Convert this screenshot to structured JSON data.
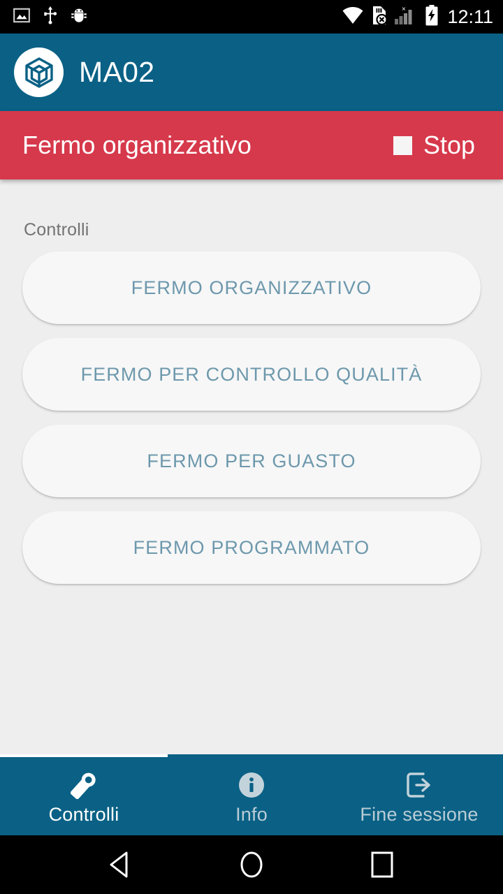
{
  "status_bar": {
    "time": "12:11",
    "left_icons": [
      "screenshot-icon",
      "usb-icon",
      "android-debug-icon"
    ],
    "right_icons": [
      "wifi-icon",
      "no-sim-card-icon",
      "cell-signal-icon",
      "battery-charging-icon"
    ]
  },
  "app_bar": {
    "title": "MA02",
    "logo_icon": "cube-logo-icon",
    "background_color": "#0a6185"
  },
  "alert_banner": {
    "message": "Fermo organizzativo",
    "action_label": "Stop",
    "action_icon": "stop-square-icon",
    "background_color": "#d6394b"
  },
  "content": {
    "section_label": "Controlli",
    "buttons": [
      {
        "label": "FERMO ORGANIZZATIVO"
      },
      {
        "label": "FERMO PER CONTROLLO QUALITÀ"
      },
      {
        "label": "FERMO PER GUASTO"
      },
      {
        "label": "FERMO PROGRAMMATO"
      }
    ],
    "button_text_color": "#6d98ac"
  },
  "bottom_nav": {
    "items": [
      {
        "label": "Controlli",
        "icon": "wrench-icon",
        "active": true
      },
      {
        "label": "Info",
        "icon": "info-circle-icon",
        "active": false
      },
      {
        "label": "Fine sessione",
        "icon": "exit-session-icon",
        "active": false
      }
    ]
  },
  "android_nav": {
    "back": "back-triangle-icon",
    "home": "home-circle-icon",
    "recents": "recents-square-icon"
  }
}
